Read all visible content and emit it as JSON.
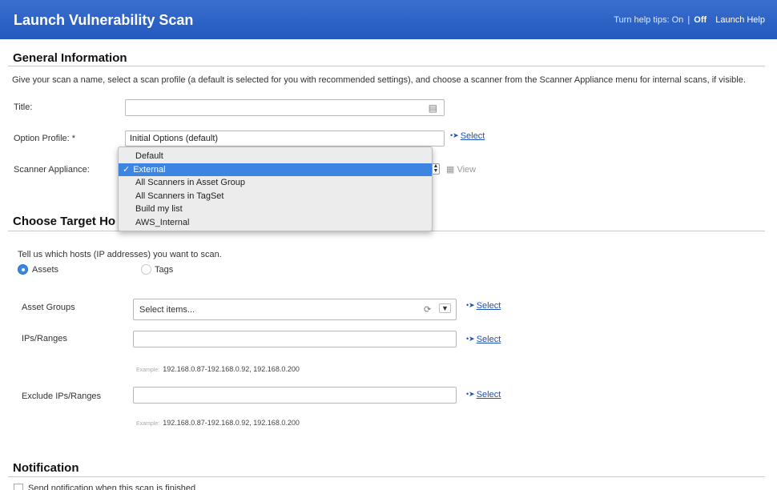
{
  "header": {
    "title": "Launch Vulnerability Scan",
    "help_tips_label": "Turn help tips:",
    "help_on": "On",
    "help_sep": "|",
    "help_off": "Off",
    "launch_help": "Launch Help"
  },
  "general": {
    "section_title": "General Information",
    "description": "Give your scan a name, select a scan profile (a default is selected for you with recommended settings), and choose a scanner from the Scanner Appliance menu for internal scans, if visible.",
    "title_label": "Title:",
    "title_value": "",
    "option_profile_label": "Option Profile: *",
    "option_profile_value": "Initial Options (default)",
    "option_profile_select": "Select",
    "scanner_label": "Scanner Appliance:",
    "scanner_view": "View",
    "scanner_options": [
      "Default",
      "External",
      "All Scanners in Asset Group",
      "All Scanners in TagSet",
      "Build my list",
      "AWS_Internal"
    ],
    "scanner_selected": "External"
  },
  "targets": {
    "section_title": "Choose Target Ho",
    "description": "Tell us which hosts (IP addresses) you want to scan.",
    "radio_assets": "Assets",
    "radio_tags": "Tags",
    "asset_groups_label": "Asset Groups",
    "asset_groups_placeholder": "Select items...",
    "asset_groups_select": "Select",
    "ips_label": "IPs/Ranges",
    "ips_select": "Select",
    "ips_example_prefix": "Example:",
    "ips_example": "192.168.0.87-192.168.0.92, 192.168.0.200",
    "exclude_label": "Exclude IPs/Ranges",
    "exclude_select": "Select",
    "exclude_example_prefix": "Example:",
    "exclude_example": "192.168.0.87-192.168.0.92, 192.168.0.200"
  },
  "notification": {
    "section_title": "Notification",
    "checkbox_label": "Send notification when this scan is finished"
  },
  "colors": {
    "header_blue": "#2c63c6",
    "link_blue": "#1d4fb8",
    "selection_blue": "#3d85e0"
  }
}
